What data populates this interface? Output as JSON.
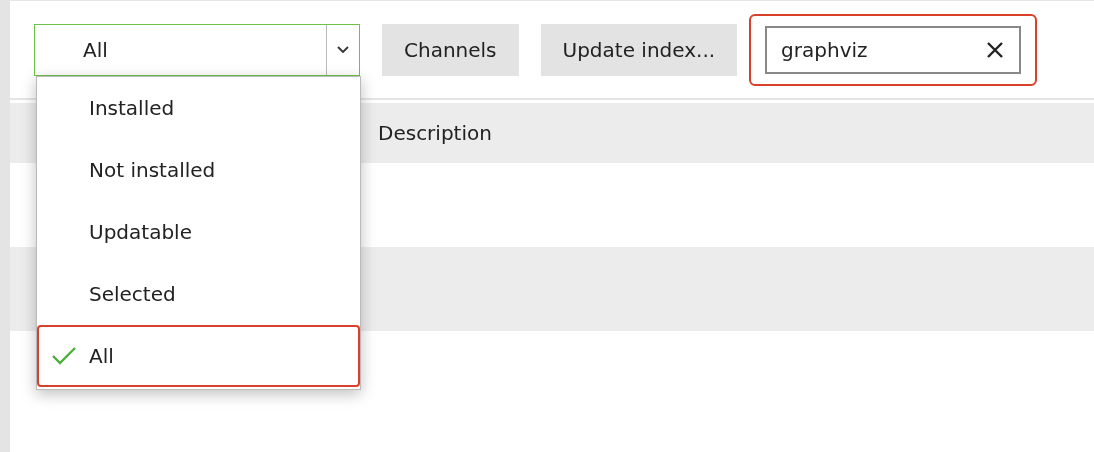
{
  "filter": {
    "value": "All",
    "options": [
      {
        "label": "Installed",
        "selected": false,
        "highlighted": false
      },
      {
        "label": "Not installed",
        "selected": false,
        "highlighted": false
      },
      {
        "label": "Updatable",
        "selected": false,
        "highlighted": false
      },
      {
        "label": "Selected",
        "selected": false,
        "highlighted": false
      },
      {
        "label": "All",
        "selected": true,
        "highlighted": true
      }
    ]
  },
  "buttons": [
    "Channels",
    "Update index..."
  ],
  "search": {
    "value": "graphviz",
    "highlighted": true
  },
  "table": {
    "columns": [
      "Description"
    ]
  }
}
